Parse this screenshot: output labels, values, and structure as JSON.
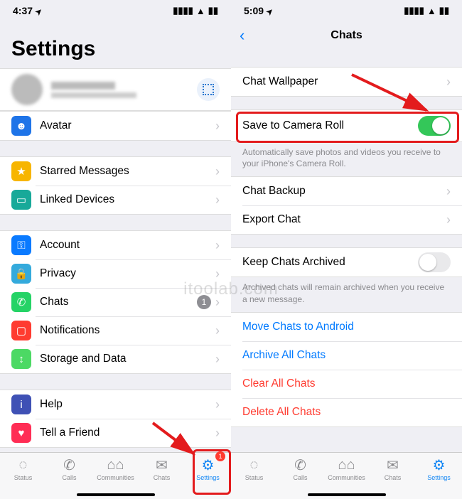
{
  "watermark": "itoolab.com",
  "left": {
    "time": "4:37",
    "title": "Settings",
    "avatar_row": "Avatar",
    "g1": {
      "starred": "Starred Messages",
      "linked": "Linked Devices"
    },
    "g2": {
      "account": "Account",
      "privacy": "Privacy",
      "chats": "Chats",
      "chats_badge": "1",
      "notifications": "Notifications",
      "storage": "Storage and Data"
    },
    "g3": {
      "help": "Help",
      "tell": "Tell a Friend"
    },
    "tabs": {
      "status": "Status",
      "calls": "Calls",
      "communities": "Communities",
      "chats": "Chats",
      "settings": "Settings",
      "badge": "1"
    }
  },
  "right": {
    "time": "5:09",
    "nav_title": "Chats",
    "wallpaper": "Chat Wallpaper",
    "save_roll": "Save to Camera Roll",
    "save_desc": "Automatically save photos and videos you receive to your iPhone's Camera Roll.",
    "backup": "Chat Backup",
    "export": "Export Chat",
    "keep": "Keep Chats Archived",
    "keep_desc": "Archived chats will remain archived when you receive a new message.",
    "move": "Move Chats to Android",
    "archive": "Archive All Chats",
    "clear": "Clear All Chats",
    "delete": "Delete All Chats",
    "tabs": {
      "status": "Status",
      "calls": "Calls",
      "communities": "Communities",
      "chats": "Chats",
      "settings": "Settings"
    }
  }
}
